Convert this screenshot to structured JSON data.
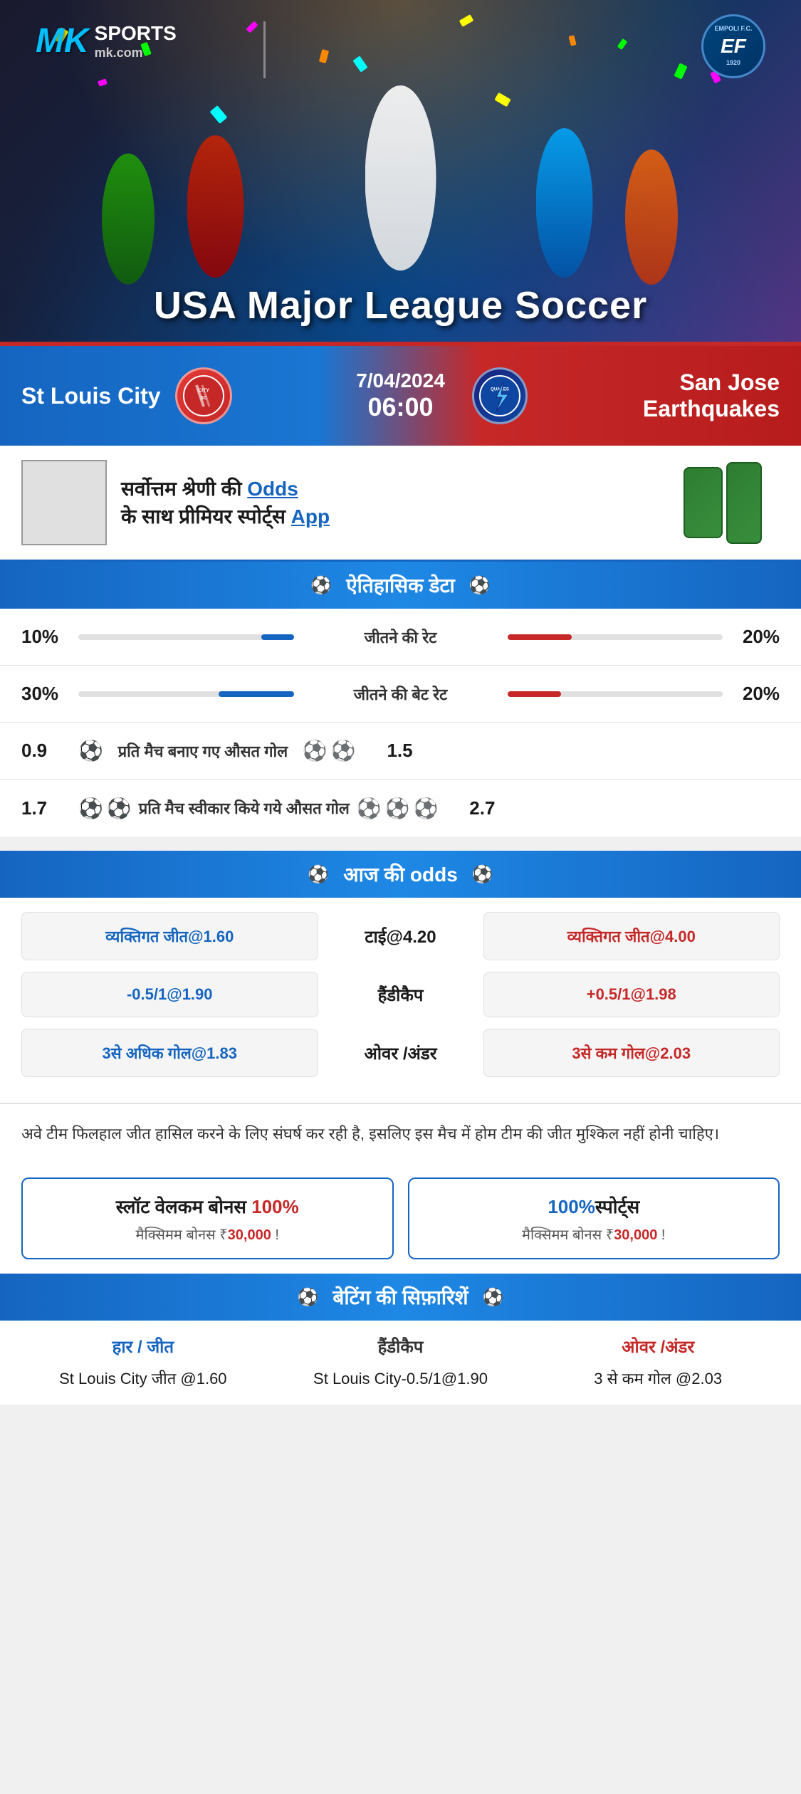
{
  "hero": {
    "logo_mk": "MK",
    "logo_sports": "SPORTS",
    "logo_site": "mk.com",
    "logo_empoli": "EMPOLI F.C.\n1920",
    "title": "USA Major League Soccer"
  },
  "match": {
    "home_team": "St Louis City",
    "away_team": "San Jose Earthquakes",
    "away_team_short": "QUAKES",
    "date": "7/04/2024",
    "time": "06:00"
  },
  "app_banner": {
    "text_line1": "सर्वोत्तम श्रेणी की",
    "text_highlight": "Odds",
    "text_line2": "के साथ प्रीमियर स्पोर्ट्स",
    "text_app": "App"
  },
  "historical": {
    "section_title": "ऐतिहासिक डेटा",
    "rows": [
      {
        "label": "जीतने की रेट",
        "left_val": "10%",
        "right_val": "20%",
        "left_fill": 15,
        "right_fill": 30
      },
      {
        "label": "जीतने की बेट रेट",
        "left_val": "30%",
        "right_val": "20%",
        "left_fill": 35,
        "right_fill": 25
      },
      {
        "label": "प्रति मैच बनाए गए औसत गोल",
        "left_val": "0.9",
        "right_val": "1.5",
        "left_icons": 1,
        "right_icons": 2
      },
      {
        "label": "प्रति मैच स्वीकार किये गये औसत गोल",
        "left_val": "1.7",
        "right_val": "2.7",
        "left_icons": 2,
        "right_icons": 3
      }
    ]
  },
  "odds": {
    "section_title": "आज की odds",
    "rows": [
      {
        "left_label": "व्यक्तिगत जीत@1.60",
        "center_label": "टाई@4.20",
        "right_label": "व्यक्तिगत जीत@4.00",
        "left_color": "blue",
        "right_color": "red"
      },
      {
        "left_label": "-0.5/1@1.90",
        "center_label": "हैंडीकैप",
        "right_label": "+0.5/1@1.98",
        "left_color": "blue",
        "right_color": "red"
      },
      {
        "left_label": "3से अधिक गोल@1.83",
        "center_label": "ओवर /अंडर",
        "right_label": "3से कम गोल@2.03",
        "left_color": "blue",
        "right_color": "red"
      }
    ]
  },
  "analysis": {
    "text": "अवे टीम फिलहाल जीत हासिल करने के लिए संघर्ष कर रही है, इसलिए इस मैच में होम टीम की जीत मुश्किल नहीं होनी चाहिए।"
  },
  "bonus": {
    "section1": {
      "title_prefix": "स्लॉट वेलकम बोनस ",
      "percent": "100%",
      "subtitle_prefix": "मैक्सिमम बोनस ₹",
      "amount": "30,000",
      "suffix": " !"
    },
    "section2": {
      "title_prefix": "100%",
      "title_suffix": "स्पोर्ट्स",
      "subtitle_prefix": "मैक्सिमम बोनस  ₹",
      "amount": "30,000",
      "suffix": " !"
    }
  },
  "betting_recs": {
    "section_title": "बेटिंग की सिफ़ारिशें",
    "cols": [
      {
        "header": "हार / जीत",
        "value": "St Louis City जीत @1.60",
        "color": "blue"
      },
      {
        "header": "हैंडीकैप",
        "value": "St Louis City-0.5/1@1.90",
        "color": "default"
      },
      {
        "header": "ओवर /अंडर",
        "value": "3 से कम गोल @2.03",
        "color": "red"
      }
    ]
  }
}
